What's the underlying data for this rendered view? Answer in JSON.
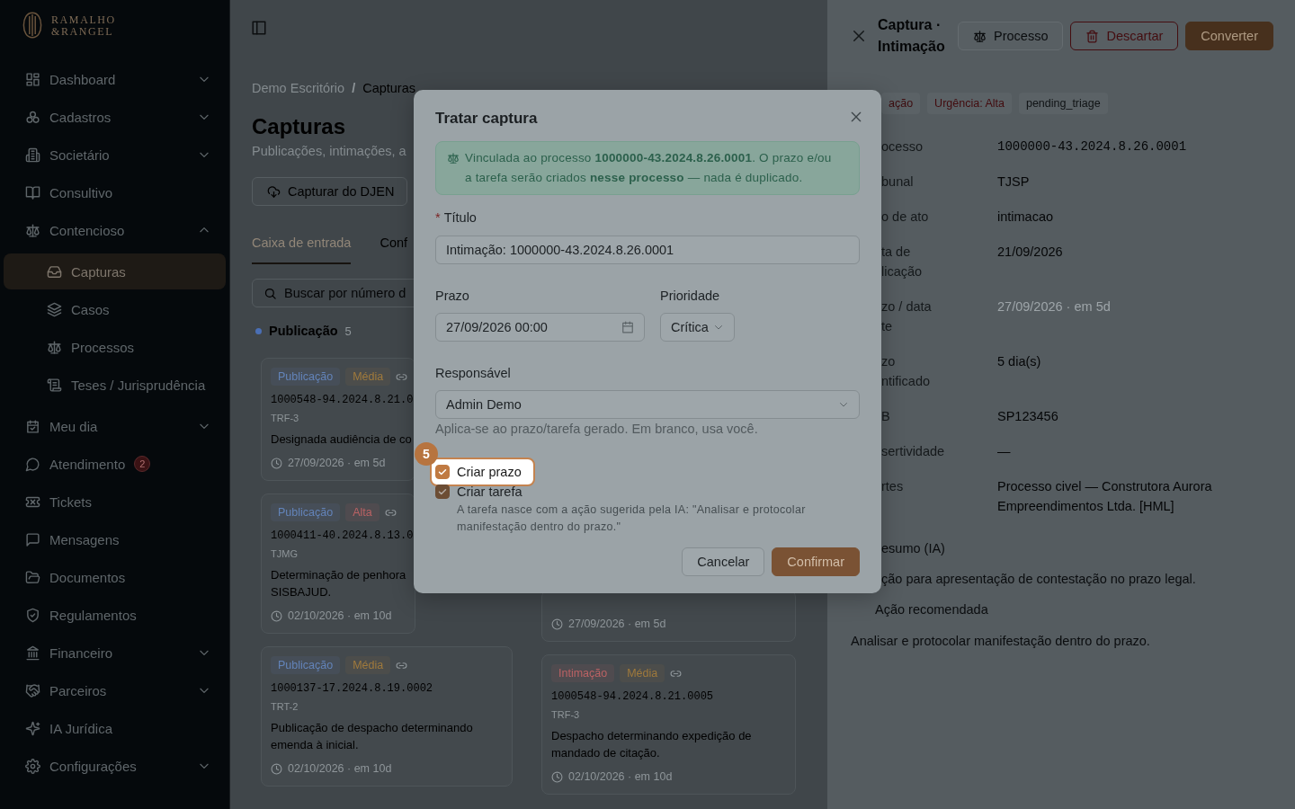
{
  "sidebar": {
    "logo": {
      "line_1": "RAMALHO",
      "line_2": "&RANGEL"
    },
    "items": [
      {
        "label": "Dashboard",
        "kind": "group",
        "expanded": false,
        "selected": false
      },
      {
        "label": "Cadastros",
        "kind": "group",
        "expanded": false,
        "selected": false
      },
      {
        "label": "Societário",
        "kind": "group",
        "expanded": false,
        "selected": false
      },
      {
        "label": "Consultivo",
        "kind": "link",
        "selected": false
      },
      {
        "label": "Contencioso",
        "kind": "group",
        "expanded": true,
        "selected": false,
        "children": [
          {
            "label": "Capturas",
            "selected": true
          },
          {
            "label": "Casos",
            "selected": false
          },
          {
            "label": "Processos",
            "selected": false
          },
          {
            "label": "Teses / Jurisprudência",
            "selected": false
          }
        ]
      },
      {
        "label": "Meu dia",
        "kind": "group",
        "expanded": false,
        "selected": false
      },
      {
        "label": "Atendimento",
        "kind": "link",
        "selected": false,
        "badge": "2"
      },
      {
        "label": "Tickets",
        "kind": "link",
        "selected": false
      },
      {
        "label": "Mensagens",
        "kind": "link",
        "selected": false
      },
      {
        "label": "Documentos",
        "kind": "link",
        "selected": false
      },
      {
        "label": "Regulamentos",
        "kind": "link",
        "selected": false
      },
      {
        "label": "Financeiro",
        "kind": "group",
        "expanded": false,
        "selected": false
      },
      {
        "label": "Parceiros",
        "kind": "group",
        "expanded": false,
        "selected": false
      },
      {
        "label": "IA Jurídica",
        "kind": "link",
        "selected": false
      },
      {
        "label": "Configurações",
        "kind": "group",
        "expanded": false,
        "selected": false
      }
    ]
  },
  "page": {
    "breadcrumb": [
      "Demo Escritório",
      "Capturas"
    ],
    "breadcrumb_separator": "/",
    "title": "Capturas",
    "subtitle": "Publicações, intimações, a",
    "capture_button": "Capturar do DJEN",
    "tabs": [
      {
        "label": "Caixa de entrada",
        "selected": true
      },
      {
        "label": "Conf",
        "selected": false
      }
    ],
    "search": {
      "placeholder": "Buscar por número d"
    }
  },
  "board": {
    "columns": [
      {
        "title": "Publicação",
        "count": "5",
        "color": "#4a6fb5",
        "cards": [
          {
            "tags": [
              {
                "label": "Publicação",
                "color": "#6384ba"
              },
              {
                "label": "Média",
                "color": "#a07a3c"
              }
            ],
            "linked": true,
            "number": "1000548-94.2024.8.21.0",
            "court": "TRF-3",
            "description": [
              "Designada audiência de co"
            ],
            "due": "27/09/2026 · em 5d"
          },
          {
            "tags": [
              {
                "label": "Publicação",
                "color": "#6384ba"
              },
              {
                "label": "Alta",
                "color": "#bb6264"
              }
            ],
            "linked": true,
            "number": "1000411-40.2024.8.13.0",
            "court": "TJMG",
            "description": [
              "Determinação de penhora",
              "SISBAJUD."
            ],
            "due": "02/10/2026 · em 10d"
          },
          {
            "tags": [
              {
                "label": "Publicação",
                "color": "#6384ba"
              },
              {
                "label": "Média",
                "color": "#a07a3c"
              }
            ],
            "linked": true,
            "number": "1000137-17.2024.8.19.0002",
            "court": "TRT-2",
            "description": [
              "Publicação de despacho determinando",
              "emenda à inicial."
            ],
            "due": "02/10/2026 · em 10d"
          }
        ]
      },
      {
        "cards": [
          {
            "due": "27/09/2026 · em 5d"
          },
          {
            "tags": [
              {
                "label": "Intimação",
                "color": "#bb6264"
              },
              {
                "label": "Média",
                "color": "#a07a3c"
              }
            ],
            "linked": true,
            "number": "1000548-94.2024.8.21.0005",
            "court": "TRF-3",
            "description": [
              "Despacho determinando expedição de",
              "mandado de citação."
            ],
            "due": "02/10/2026 · em 10d"
          }
        ]
      }
    ]
  },
  "drawer": {
    "title": "Captura · Intimação",
    "buttons": [
      {
        "label": "Processo",
        "kind": "default"
      },
      {
        "label": "Descartar",
        "kind": "danger"
      },
      {
        "label": "Converter",
        "kind": "primary"
      }
    ],
    "tags": [
      {
        "label": "ação",
        "color": "#3d0c0f"
      },
      {
        "label": "Urgência: Alta",
        "color": "#420b0e"
      },
      {
        "label": "pending_triage",
        "color": "#0f1214"
      }
    ],
    "fields": [
      {
        "label": [
          "ocesso"
        ],
        "value": "1000000-43.2024.8.26.0001",
        "kind": "mono"
      },
      {
        "label": [
          "bunal"
        ],
        "value": "TJSP",
        "kind": "text"
      },
      {
        "label": [
          "o de ato"
        ],
        "value": "intimacao",
        "kind": "text"
      },
      {
        "label": [
          "ta de",
          "licação"
        ],
        "value": "21/09/2026",
        "kind": "text"
      },
      {
        "label": [
          "zo / data",
          "te"
        ],
        "value": "27/09/2026 · em 5d",
        "kind": "deadline"
      },
      {
        "label": [
          "zo",
          "ntificado"
        ],
        "value": "5 dia(s)",
        "kind": "text"
      },
      {
        "label": [
          "B"
        ],
        "value": "SP123456",
        "kind": "text"
      },
      {
        "label": [
          "sertividade"
        ],
        "value": "—",
        "kind": "text"
      },
      {
        "label": [
          "rtes"
        ],
        "value": "Processo civel — Construtora Aurora Empreendimentos Ltda. [HML]",
        "kind": "text"
      }
    ],
    "summary": {
      "heading": "esumo (IA)",
      "text": "ção para apresentação de contestação no prazo legal."
    },
    "recommendation": {
      "heading": "Ação recomendada",
      "text": "Analisar e protocolar manifestação dentro do prazo."
    }
  },
  "modal": {
    "title": "Tratar captura",
    "alert": "Vinculada ao processo **1000000-43.2024.8.26.0001**. O prazo e/ou a tarefa serão criados **nesse processo** — nada é duplicado.",
    "title_field": {
      "label": "Título",
      "required_mark": "*",
      "value": "Intimação: 1000000-43.2024.8.26.0001"
    },
    "deadline_field": {
      "label": "Prazo",
      "value": "27/09/2026 00:00"
    },
    "priority_field": {
      "label": "Prioridade",
      "value": "Crítica"
    },
    "assignee_field": {
      "label": "Responsável",
      "value": "Admin Demo",
      "help": "Aplica-se ao prazo/tarefa gerado. Em branco, usa você."
    },
    "options": [
      {
        "label": "Criar prazo",
        "checked": true,
        "highlighted": true
      },
      {
        "label": "Criar tarefa",
        "checked": true,
        "highlighted": false,
        "hint": "A tarefa nasce com a ação sugerida pela IA: \"Analisar e protocolar manifestação dentro do prazo.\""
      }
    ],
    "buttons": [
      {
        "label": "Cancelar",
        "kind": "default"
      },
      {
        "label": "Confirmar",
        "kind": "primary"
      }
    ]
  },
  "tour": {
    "step": "5"
  }
}
